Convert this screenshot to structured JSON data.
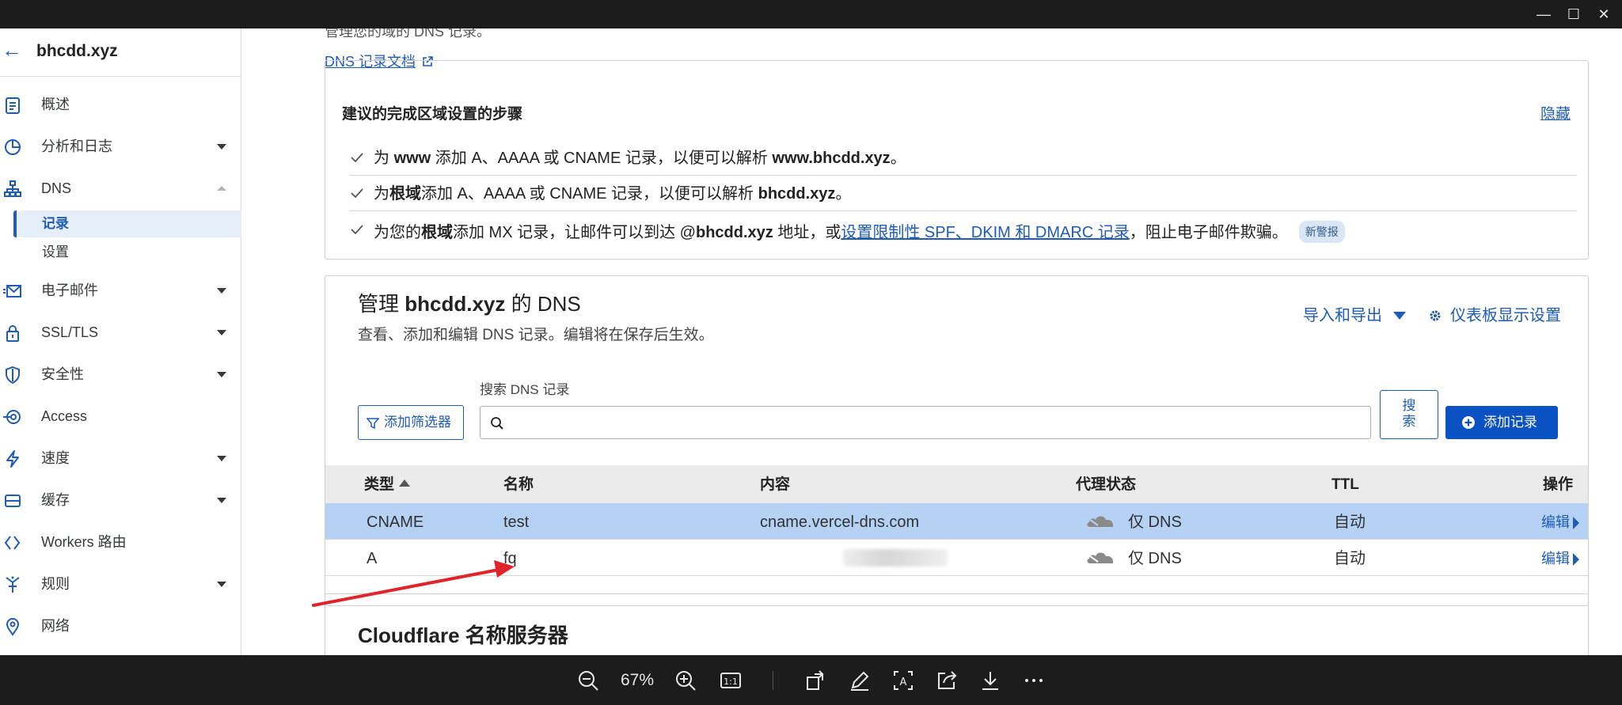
{
  "window": {
    "minimize": "—",
    "maximize": "☐",
    "close": "✕"
  },
  "sidebar": {
    "domain": "bhcdd.xyz",
    "items": [
      {
        "label": "概述",
        "icon": "clipboard-icon",
        "caret": "none"
      },
      {
        "label": "分析和日志",
        "icon": "pie-chart-icon",
        "caret": "down"
      },
      {
        "label": "DNS",
        "icon": "network-icon",
        "caret": "up"
      },
      {
        "label": "电子邮件",
        "icon": "mail-icon",
        "caret": "down"
      },
      {
        "label": "SSL/TLS",
        "icon": "lock-icon",
        "caret": "down"
      },
      {
        "label": "安全性",
        "icon": "shield-icon",
        "caret": "down"
      },
      {
        "label": "Access",
        "icon": "access-icon",
        "caret": "none"
      },
      {
        "label": "速度",
        "icon": "bolt-icon",
        "caret": "down"
      },
      {
        "label": "缓存",
        "icon": "storage-icon",
        "caret": "down"
      },
      {
        "label": "Workers 路由",
        "icon": "workers-icon",
        "caret": "none"
      },
      {
        "label": "规则",
        "icon": "rules-icon",
        "caret": "down"
      },
      {
        "label": "网络",
        "icon": "location-icon",
        "caret": "none"
      }
    ],
    "dns_sub": [
      {
        "label": "记录",
        "active": true
      },
      {
        "label": "设置",
        "active": false
      }
    ]
  },
  "main": {
    "cut_text": "管理您的域的 DNS 记录。",
    "doc_link": "DNS 记录文档",
    "steps": {
      "title": "建议的完成区域设置的步骤",
      "hide": "隐藏",
      "rows": [
        {
          "p1": "为 ",
          "b1": "www",
          "p2": " 添加 A、AAAA 或 CNAME 记录，以便可以解析 ",
          "b2": "www.bhcdd.xyz",
          "p3": "。"
        },
        {
          "p1": "为",
          "b1": "根域",
          "p2": "添加 A、AAAA 或 CNAME 记录，以便可以解析 ",
          "b2": "bhcdd.xyz",
          "p3": "。"
        },
        {
          "p1": "为您的",
          "b1": "根域",
          "p2": "添加 MX 记录，让邮件可以到达 @",
          "b2": "bhcdd.xyz",
          "p3": " 地址，或",
          "link": "设置限制性 SPF、DKIM 和 DMARC 记录",
          "p4": "，阻止电子邮件欺骗。",
          "badge": "新警报"
        }
      ]
    },
    "dns": {
      "title_pre": "管理 ",
      "title_domain": "bhcdd.xyz",
      "title_post": " 的 DNS",
      "subtitle": "查看、添加和编辑 DNS 记录。编辑将在保存后生效。",
      "import_export": "导入和导出",
      "dashboard_settings": "仪表板显示设置",
      "search_label": "搜索 DNS 记录",
      "search_value": "",
      "search_placeholder": "",
      "filter_button": "添加筛选器",
      "search_button_line1": "搜",
      "search_button_line2": "索",
      "add_button": "添加记录",
      "columns": {
        "type": "类型",
        "name": "名称",
        "content": "内容",
        "proxy": "代理状态",
        "ttl": "TTL",
        "actions": "操作"
      },
      "records": [
        {
          "type": "CNAME",
          "name": "test",
          "content": "cname.vercel-dns.com",
          "proxy": "仅 DNS",
          "ttl": "自动",
          "edit": "编辑"
        },
        {
          "type": "A",
          "name": "fq",
          "content": "",
          "proxy": "仅 DNS",
          "ttl": "自动",
          "edit": "编辑"
        }
      ]
    },
    "nameservers_title": "Cloudflare 名称服务器"
  },
  "toolbar": {
    "zoom": "67%"
  },
  "colors": {
    "accent": "#1f5cb8",
    "primary_button": "#0a51c4",
    "selected_row": "#b5d2f4",
    "annotation_arrow": "#e0242a"
  }
}
